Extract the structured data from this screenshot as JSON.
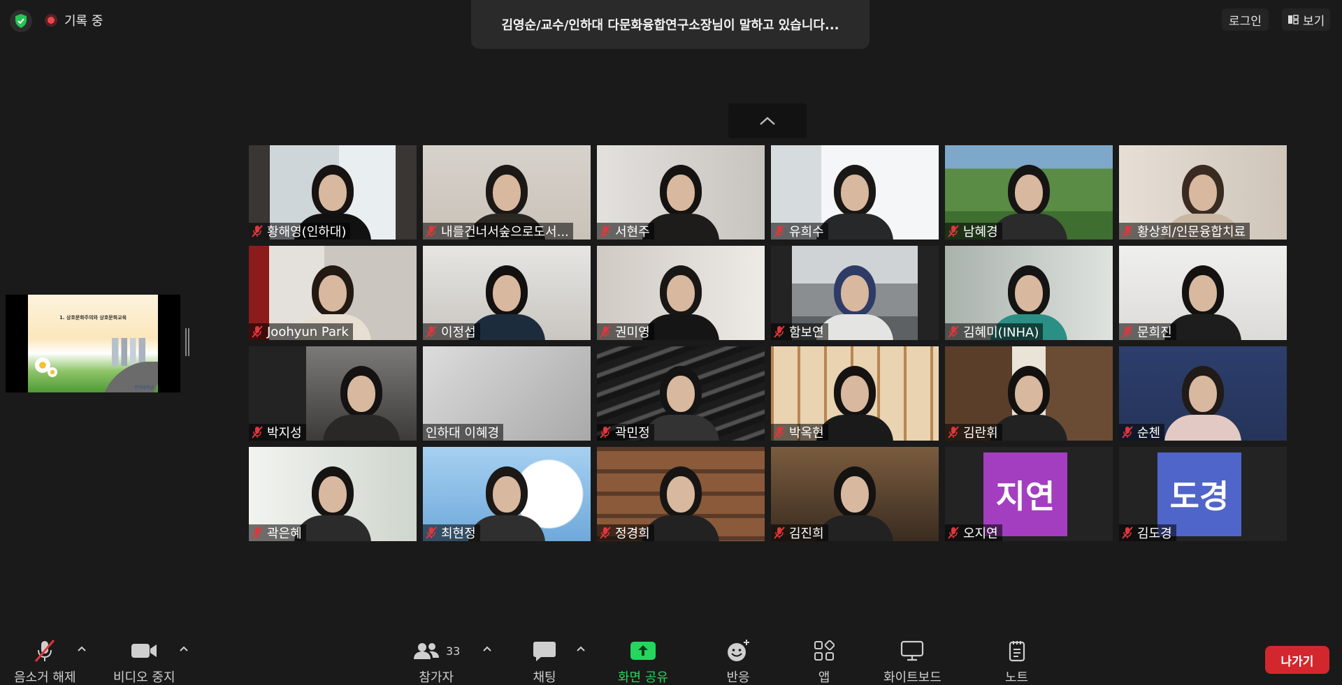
{
  "meta": {
    "domain": "Computer-Use"
  },
  "top": {
    "recording_label": "기록 중",
    "speaker_banner": "김영순/교수/인하대 다문화융합연구소장님이 말하고 있습니다...",
    "login_label": "로그인",
    "view_label": "보기"
  },
  "shared_screen": {
    "slide_title": "1. 상호문화주의와 상호문화교육",
    "slide_logo": "인하대학교"
  },
  "participants": [
    {
      "name": "황해영(인하대)",
      "muted": true
    },
    {
      "name": "내를건너서숲으로도서...",
      "muted": true
    },
    {
      "name": "서현주",
      "muted": true
    },
    {
      "name": "유희수",
      "muted": true
    },
    {
      "name": "남혜경",
      "muted": true
    },
    {
      "name": "황상희/인문융합치료",
      "muted": true
    },
    {
      "name": "Joohyun Park",
      "muted": true
    },
    {
      "name": "이정섭",
      "muted": true
    },
    {
      "name": "권미영",
      "muted": true
    },
    {
      "name": "함보연",
      "muted": true
    },
    {
      "name": "김혜미(INHA)",
      "muted": true
    },
    {
      "name": "문희진",
      "muted": true
    },
    {
      "name": "박지성",
      "muted": true
    },
    {
      "name": "인하대 이혜경",
      "muted": false
    },
    {
      "name": "곽민정",
      "muted": true
    },
    {
      "name": "박옥현",
      "muted": true
    },
    {
      "name": "김란휘",
      "muted": true
    },
    {
      "name": "순첸",
      "muted": true
    },
    {
      "name": "곽은혜",
      "muted": true
    },
    {
      "name": "최현정",
      "muted": true
    },
    {
      "name": "정경희",
      "muted": true
    },
    {
      "name": "김진희",
      "muted": true
    },
    {
      "name": "오지연",
      "muted": true,
      "avatar_text": "지연",
      "avatar_color": "#a33ec0"
    },
    {
      "name": "김도경",
      "muted": true,
      "avatar_text": "도경",
      "avatar_color": "#5065c9"
    }
  ],
  "toolbar": {
    "unmute_label": "음소거 해제",
    "stop_video_label": "비디오 중지",
    "participants_label": "참가자",
    "participants_count": "33",
    "chat_label": "채팅",
    "share_label": "화면 공유",
    "reactions_label": "반응",
    "apps_label": "앱",
    "whiteboard_label": "화이트보드",
    "notes_label": "노트",
    "leave_label": "나가기"
  },
  "colors": {
    "background": "#1a1a1a",
    "share_green": "#24d65c",
    "leave_red": "#d3272e",
    "muted_red": "#e0363c"
  }
}
